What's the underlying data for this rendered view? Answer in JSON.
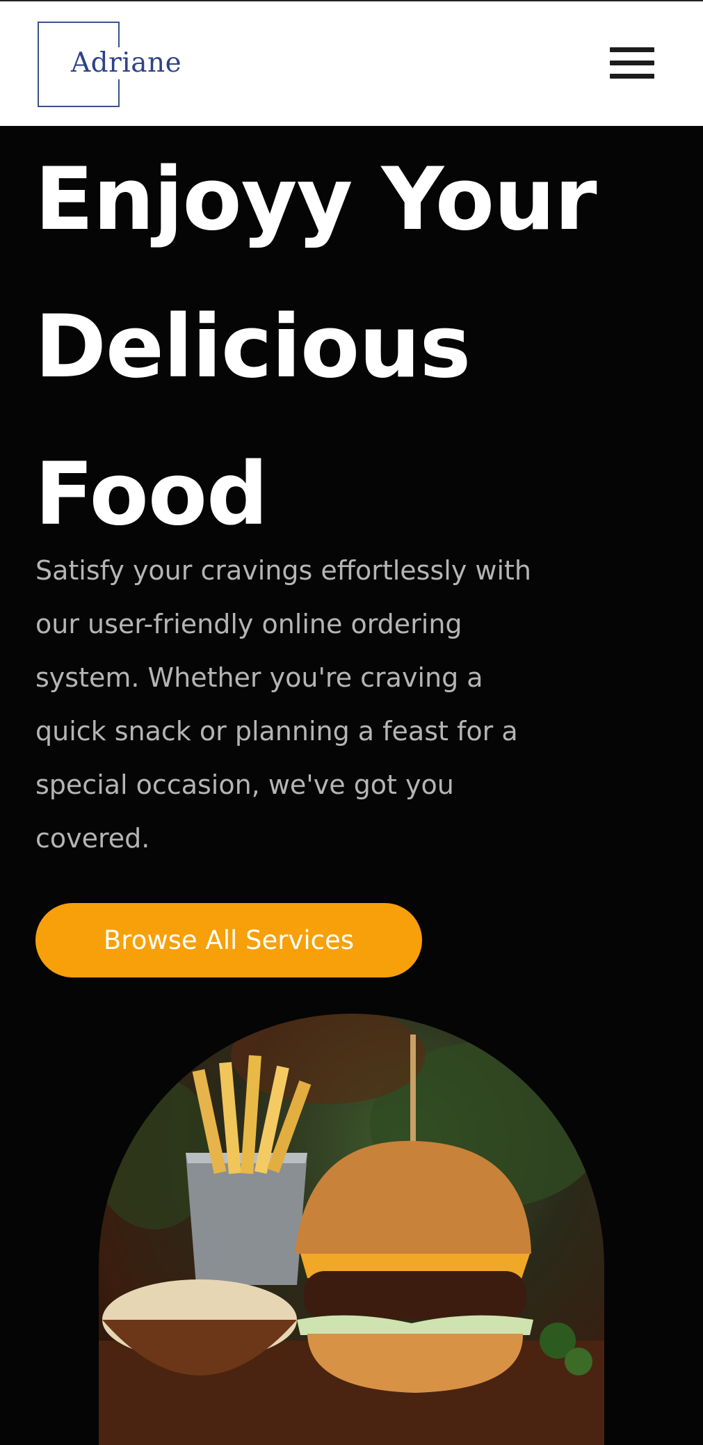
{
  "header": {
    "logo_text": "Adriane",
    "menu_icon": "hamburger-menu-icon"
  },
  "hero": {
    "title_lines": [
      "Enjoyy Your",
      "Delicious",
      "Food"
    ],
    "description_lines": [
      "Satisfy your cravings effortlessly with",
      "our user-friendly online ordering",
      "system. Whether you're craving a",
      "quick snack or planning a feast for a",
      "special occasion, we've got you",
      "covered."
    ],
    "cta_label": "Browse All Services"
  },
  "colors": {
    "background": "#050505",
    "accent": "#f7a00a",
    "logo": "#2d4287"
  }
}
